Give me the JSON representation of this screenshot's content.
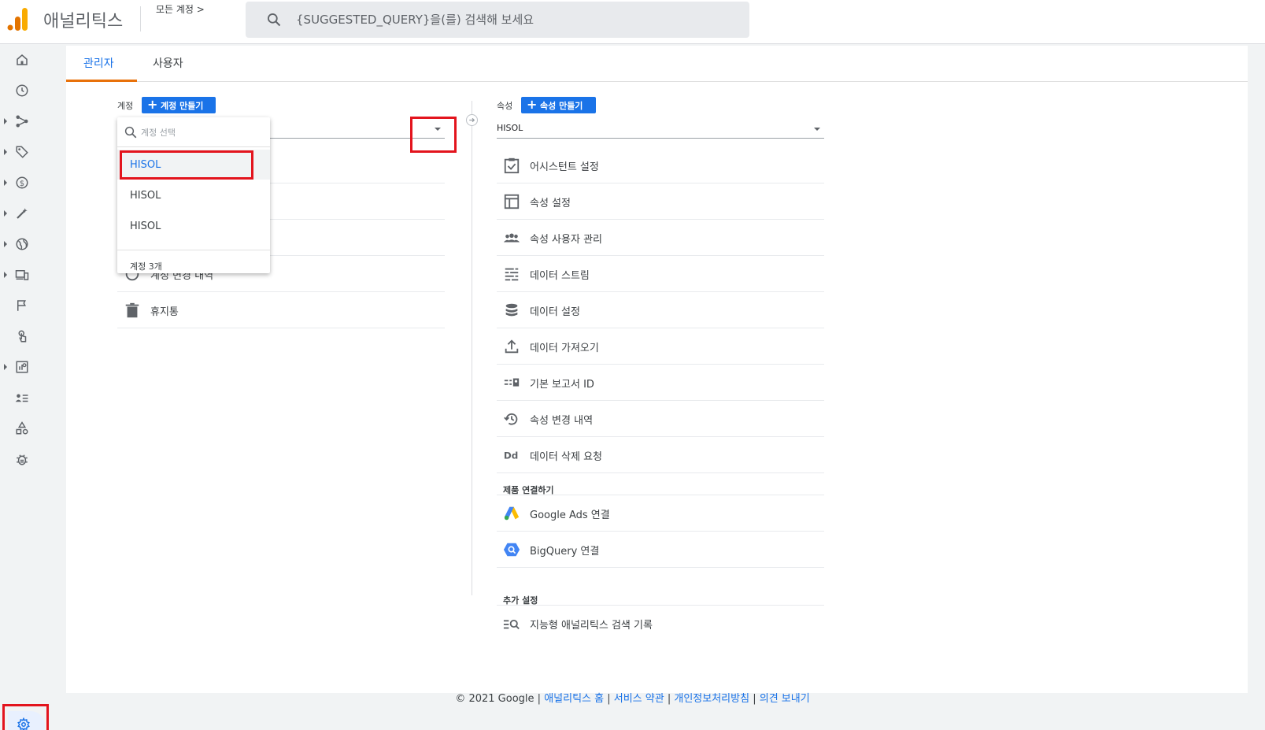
{
  "header": {
    "app_title": "애널리틱스",
    "breadcrumb": "모든 계정 >",
    "search_placeholder": "{SUGGESTED_QUERY}을(를) 검색해 보세요"
  },
  "tabs": [
    {
      "label": "관리자",
      "active": true
    },
    {
      "label": "사용자",
      "active": false
    }
  ],
  "account_column": {
    "label": "계정",
    "create_button": "계정 만들기",
    "partial_visible_item": "계정 변경 내역",
    "items": [
      {
        "label": "휴지통",
        "icon": "trash-icon"
      }
    ]
  },
  "account_dropdown": {
    "search_placeholder": "계정 선택",
    "options": [
      "HISOL",
      "HISOL",
      "HISOL"
    ],
    "selected_index": 0,
    "footer": "계정 3개"
  },
  "property_column": {
    "label": "속성",
    "create_button": "속성 만들기",
    "selected_value": "HISOL",
    "items": [
      {
        "label": "어시스턴트 설정",
        "icon": "assistant-checklist-icon"
      },
      {
        "label": "속성 설정",
        "icon": "property-settings-icon"
      },
      {
        "label": "속성 사용자 관리",
        "icon": "users-group-icon"
      },
      {
        "label": "데이터 스트림",
        "icon": "data-stream-icon"
      },
      {
        "label": "데이터 설정",
        "icon": "database-icon"
      },
      {
        "label": "데이터 가져오기",
        "icon": "upload-icon"
      },
      {
        "label": "기본 보고서 ID",
        "icon": "reporting-id-icon"
      },
      {
        "label": "속성 변경 내역",
        "icon": "history-icon"
      },
      {
        "label": "데이터 삭제 요청",
        "icon": "data-deletion-icon"
      }
    ],
    "product_links_title": "제품 연결하기",
    "product_links": [
      {
        "label": "Google Ads 연결",
        "icon": "google-ads-icon"
      },
      {
        "label": "BigQuery 연결",
        "icon": "bigquery-icon"
      }
    ],
    "additional_title": "추가 설정",
    "additional": [
      {
        "label": "지능형 애널리틱스 검색 기록",
        "icon": "search-history-icon"
      }
    ]
  },
  "footer": {
    "copyright": "© 2021 Google |",
    "links": [
      "애널리틱스 홈",
      "서비스 약관",
      "개인정보처리방침",
      "의견 보내기"
    ]
  },
  "colors": {
    "accent": "#1a73e8",
    "highlight_box": "#e3141d",
    "tab_indicator": "#e8710a"
  }
}
